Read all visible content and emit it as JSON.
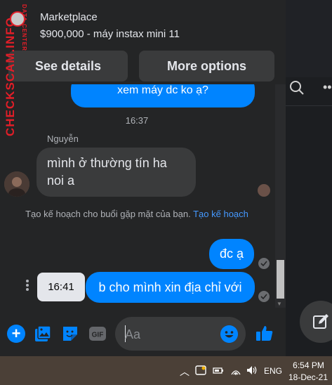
{
  "marketplace": {
    "label": "Marketplace",
    "title": "$900,000 - máy instax mini 11",
    "see_details": "See details",
    "more_options": "More options"
  },
  "watermark": {
    "main": "CHECKSCAM.INFO",
    "sub": "DATA CENTER"
  },
  "messages": {
    "outgoing_top_partial": "xem máy dc ko ạ?",
    "timestamp": "16:37",
    "sender_name": "Nguyễn",
    "incoming": "mình ở thường tín ha noi a",
    "system_text": "Tạo kế hoạch cho buổi gặp mặt của bạn.",
    "system_link": "Tạo kế hoạch",
    "outgoing_small": "đc ạ",
    "outgoing_bottom": "b cho mình xin địa chỉ với",
    "hover_time": "16:41"
  },
  "composer": {
    "placeholder": "Aa",
    "gif_label": "GIF"
  },
  "taskbar": {
    "language": "ENG",
    "time": "6:54 PM",
    "date": "18-Dec-21"
  },
  "colors": {
    "accent": "#0084ff",
    "watermark": "#e21e28",
    "bubble_in": "#3a3b3c",
    "background": "#242526"
  },
  "icons": [
    "search-icon",
    "more-icon",
    "compose-icon",
    "plus-icon",
    "image-icon",
    "sticker-icon",
    "gif-icon",
    "emoji-icon",
    "like-icon",
    "seen-check-icon",
    "chevron-up-icon",
    "network-icon",
    "volume-icon",
    "battery-icon"
  ]
}
